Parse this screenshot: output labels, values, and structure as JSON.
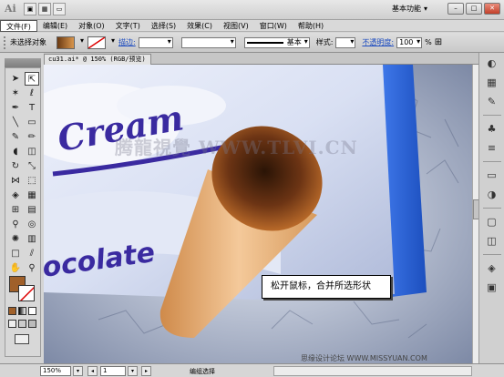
{
  "app": {
    "logo": "Ai",
    "workspace": "基本功能"
  },
  "menu": [
    "文件(F)",
    "编辑(E)",
    "对象(O)",
    "文字(T)",
    "选择(S)",
    "效果(C)",
    "视图(V)",
    "窗口(W)",
    "帮助(H)"
  ],
  "control_bar": {
    "selection_label": "未选择对象",
    "stroke_label": "描边:",
    "brush_label": "基本",
    "style_label": "样式:",
    "opacity_label": "不透明度:",
    "opacity_value": "100",
    "opacity_unit": "%"
  },
  "document": {
    "tab_title": "cu31.ai* @ 150% (RGB/预览)"
  },
  "canvas": {
    "text_cream": "Cream",
    "text_chocolate": "ocolate"
  },
  "callout": {
    "text": "松开鼠标，合并所选形状"
  },
  "watermark": {
    "top": "腾龍視覺 WWW.TLVI.CN",
    "bottom": "思缘设计论坛  WWW.MISSYUAN.COM"
  },
  "status": {
    "zoom": "150%",
    "page": "1",
    "tool_text": "编组选择"
  },
  "colors": {
    "accent_blue": "#1d4cc0",
    "fill_brown": "#a0602a"
  }
}
